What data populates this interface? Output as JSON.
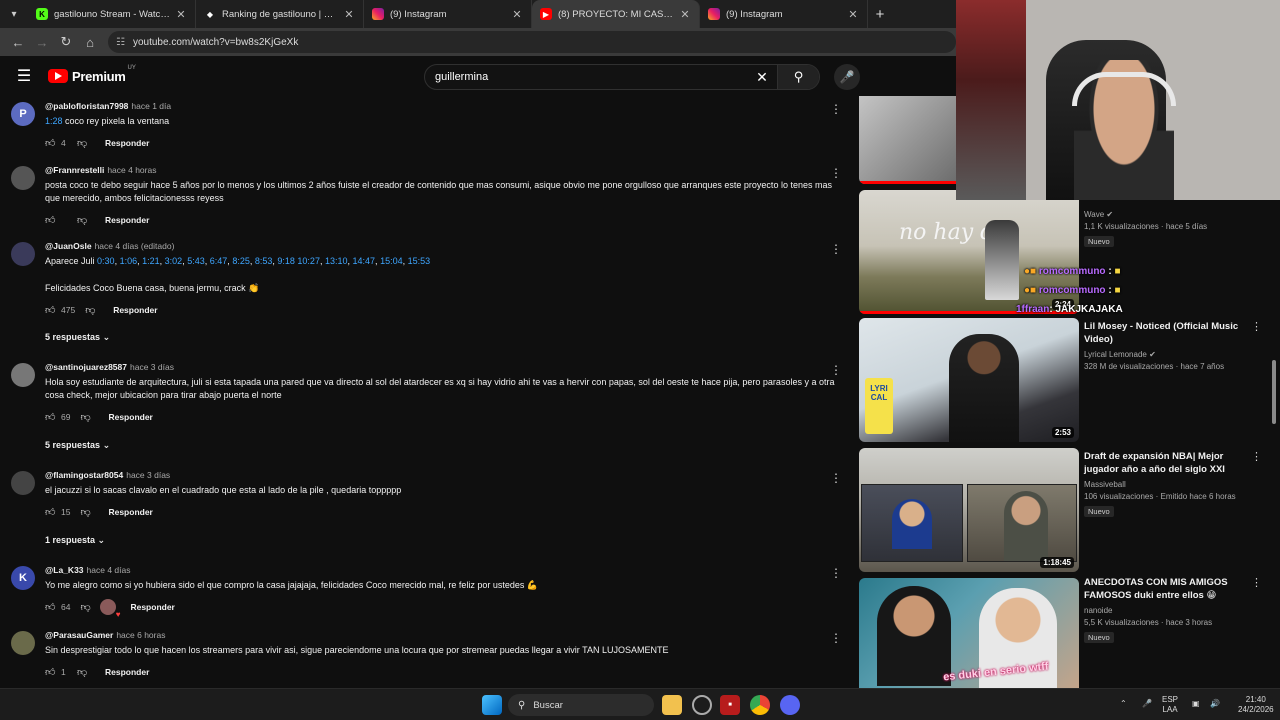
{
  "tabs": [
    {
      "label": "gastilouno Stream - Watch Live",
      "active": false,
      "favicon": "kick-icon"
    },
    {
      "label": "Ranking de gastilouno | El mej",
      "active": false,
      "favicon": "diamond-icon"
    },
    {
      "label": "(9) Instagram",
      "active": false,
      "favicon": "instagram-icon"
    },
    {
      "label": "(8) PROYECTO: MI CASA #01 - Y",
      "active": true,
      "favicon": "youtube-icon"
    },
    {
      "label": "(9) Instagram",
      "active": false,
      "favicon": "instagram-icon"
    }
  ],
  "address": {
    "url": "youtube.com/watch?v=bw8s2KjGeXk"
  },
  "youtube": {
    "brand": "Premium",
    "country": "UY",
    "search_value": "guillermina"
  },
  "comments": [
    {
      "user": "@pablofloristan7998",
      "time": "hace 1 día",
      "avatar_letter": "P",
      "avatar_color": "#5c6bc0",
      "text_ts": "1:28",
      "text": " coco rey pixela la ventana",
      "likes": "4",
      "reply": "Responder"
    },
    {
      "user": "@Frannrestelli",
      "time": "hace 4 horas",
      "avatar_letter": "",
      "avatar_color": "#555555",
      "text": "posta coco te debo seguir hace 5 años por lo menos y los ultimos 2 años fuiste el creador de contenido que mas consumi, asique obvio me pone orgulloso que arranques este proyecto lo tenes mas que merecido, ambos felicitacionesss reyess",
      "likes": "",
      "reply": "Responder"
    },
    {
      "user": "@JuanOsle",
      "time": "hace 4 días (editado)",
      "avatar_letter": "",
      "avatar_color": "#3a3a5a",
      "text_prefix": "Aparece Juli ",
      "timestamps": [
        "0:30",
        "1:06",
        "1:21",
        "3:02",
        "5:43",
        "6:47",
        "8:25",
        "8:53",
        "9:18 10:27",
        "13:10",
        "14:47",
        "15:04",
        "15:53"
      ],
      "text2": "Felicidades Coco Buena casa, buena jermu, crack 👏",
      "likes": "475",
      "reply": "Responder",
      "replies": "5 respuestas"
    },
    {
      "user": "@santinojuarez8587",
      "time": "hace 3 días",
      "avatar_letter": "",
      "avatar_color": "#777777",
      "text": "Hola soy estudiante de arquitectura, juli si esta tapada una pared que va directo al sol del atardecer es xq si hay vidrio ahi te vas a hervir con papas, sol del oeste te hace pija, pero parasoles y a otra cosa check, mejor ubicacion para tirar abajo puerta el norte",
      "likes": "69",
      "reply": "Responder",
      "replies": "5 respuestas"
    },
    {
      "user": "@flamingostar8054",
      "time": "hace 3 días",
      "avatar_letter": "",
      "avatar_color": "#444444",
      "text": "el jacuzzi si lo sacas clavalo en el cuadrado que esta al lado de la pile , quedaria toppppp",
      "likes": "15",
      "reply": "Responder",
      "replies": "1 respuesta"
    },
    {
      "user": "@La_K33",
      "time": "hace 4 días",
      "avatar_letter": "K",
      "avatar_color": "#3949ab",
      "text": "Yo me alegro como si yo hubiera sido el que compro la casa jajajaja, felicidades Coco merecido mal, re feliz por ustedes 💪",
      "likes": "64",
      "reply": "Responder"
    },
    {
      "user": "@ParasauGamer",
      "time": "hace 6 horas",
      "avatar_letter": "",
      "avatar_color": "#6a6a4a",
      "text": "Sin desprestigiar todo lo que hacen los streamers para vivir asi, sigue pareciendome una locura que por stremear puedas llegar a vivir TAN LUJOSAMENTE",
      "likes": "1",
      "reply": "Responder"
    }
  ],
  "sidebar": {
    "videos": [
      {
        "title": "",
        "channel": "Wave",
        "verified": true,
        "stats": "1,1 K visualizaciones · hace 5 días",
        "badge": "Nuevo",
        "duration": "2:24"
      },
      {
        "title": "Lil Mosey - Noticed (Official Music Video)",
        "channel": "Lyrical Lemonade",
        "verified": true,
        "stats": "328 M de visualizaciones · hace 7 años",
        "badge": "",
        "duration": "2:53"
      },
      {
        "title": "Draft de expansión NBA| Mejor jugador año a año del siglo XXI",
        "channel": "Massiveball",
        "verified": false,
        "stats": "106 visualizaciones · Emitido hace 6 horas",
        "badge": "Nuevo",
        "duration": "1:18:45"
      },
      {
        "title": "ANECDOTAS CON MIS AMIGOS FAMOSOS duki entre ellos 😁",
        "channel": "nanoide",
        "verified": false,
        "stats": "5,5 K visualizaciones · hace 3 horas",
        "badge": "Nuevo",
        "duration": ""
      }
    ],
    "thumb_text_1": "no hay dos",
    "thumb_text_4": "es duki en serio wtff",
    "lemon_text": "LYRI CAL"
  },
  "chat_overlay": [
    {
      "user": "romcommuno",
      "text": ":"
    },
    {
      "user": "romcommuno",
      "text": ":"
    },
    {
      "user": "1ffraan",
      "text": "JAKJKAJAKA"
    }
  ],
  "taskbar": {
    "search_placeholder": "Buscar",
    "lang_top": "ESP",
    "lang_bottom": "LAA",
    "time": "21:40",
    "date": "24/2/2026"
  },
  "colors": {
    "accent_red": "#ff0000",
    "link_blue": "#3ea6ff",
    "chat_purple": "#b86bff"
  }
}
